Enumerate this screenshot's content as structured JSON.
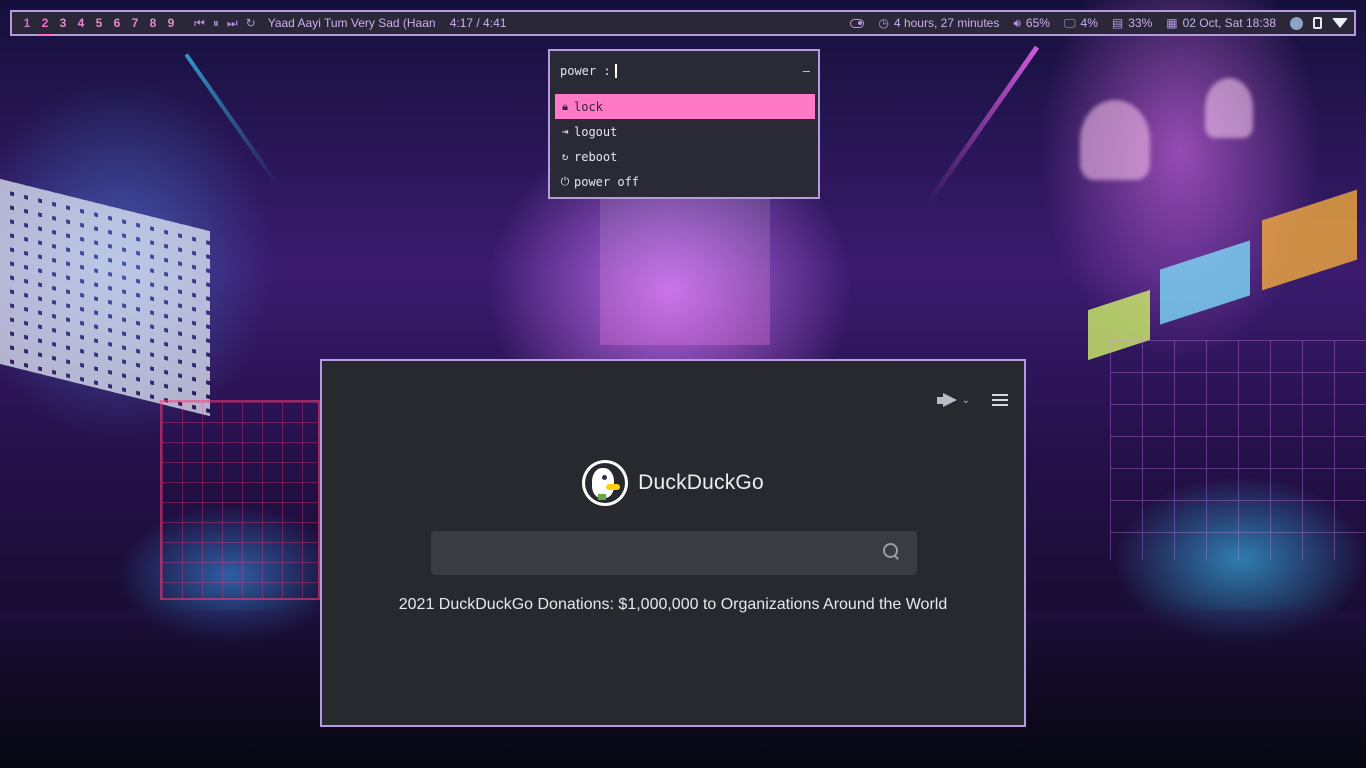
{
  "statusbar": {
    "workspaces": [
      "1",
      "2",
      "3",
      "4",
      "5",
      "6",
      "7",
      "8",
      "9"
    ],
    "active_workspace": "2",
    "media": {
      "title": "Yaad Aayi Tum Very Sad (Haan h",
      "time": "4:17 / 4:41"
    },
    "battery_time": "4 hours, 27 minutes",
    "volume": "65%",
    "cpu": "4%",
    "memory": "33%",
    "datetime": "02 Oct, Sat 18:38"
  },
  "power_menu": {
    "prompt": "power :",
    "counter": "–",
    "items": [
      {
        "label": "lock",
        "icon": "lock-icon"
      },
      {
        "label": "logout",
        "icon": "logout-icon"
      },
      {
        "label": "reboot",
        "icon": "reboot-icon"
      },
      {
        "label": "power off",
        "icon": "power-icon"
      }
    ],
    "selected_index": 0
  },
  "browser": {
    "brand": "DuckDuckGo",
    "search": {
      "value": "",
      "placeholder": ""
    },
    "promo_text": "2021 DuckDuckGo Donations: $1,000,000 to Organizations Around the World"
  },
  "colors": {
    "accent": "#b59ae0",
    "selection": "#ff79c6",
    "workspace_active": "#ff6fc8",
    "bar_bg": "#2a2738",
    "window_bg": "#27292f"
  }
}
